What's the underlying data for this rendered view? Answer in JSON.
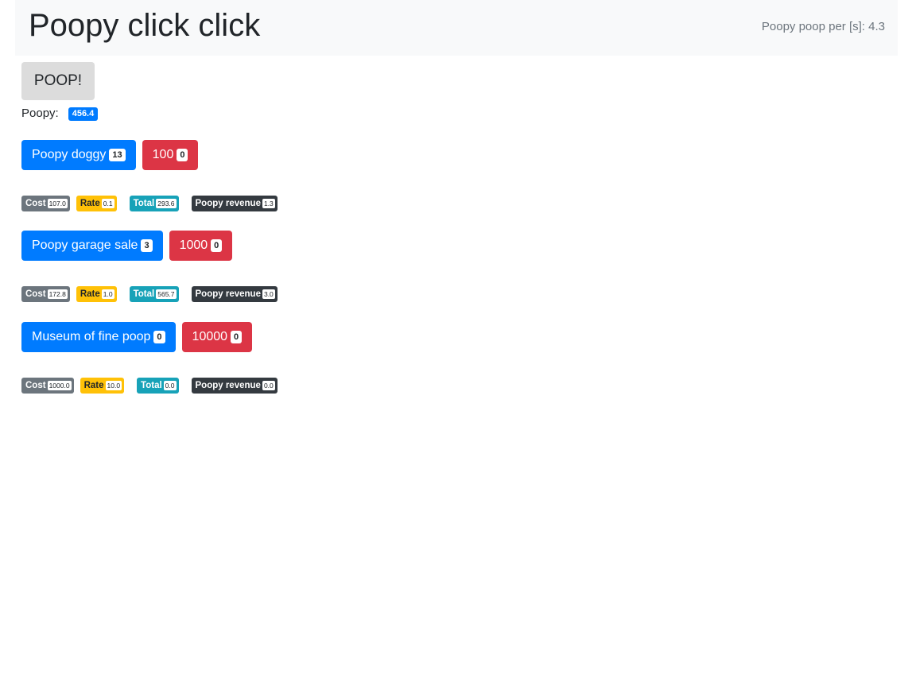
{
  "header": {
    "title": "Poopy click click",
    "rate_label": "Poopy poop per [s]: 4.3"
  },
  "clicker": {
    "button_label": "POOP!",
    "count_label": "Poopy:",
    "count_value": "456.4"
  },
  "buildings": [
    {
      "name": "Poopy doggy",
      "owned": "13",
      "bulk_label": "100",
      "bulk_count": "0",
      "cost_label": "Cost",
      "cost": "107.0",
      "rate_label": "Rate",
      "rate": "0.1",
      "total_label": "Total",
      "total": "293.6",
      "revenue_label": "Poopy revenue",
      "revenue": "1.3"
    },
    {
      "name": "Poopy garage sale",
      "owned": "3",
      "bulk_label": "1000",
      "bulk_count": "0",
      "cost_label": "Cost",
      "cost": "172.8",
      "rate_label": "Rate",
      "rate": "1.0",
      "total_label": "Total",
      "total": "565.7",
      "revenue_label": "Poopy revenue",
      "revenue": "3.0"
    },
    {
      "name": "Museum of fine poop",
      "owned": "0",
      "bulk_label": "10000",
      "bulk_count": "0",
      "cost_label": "Cost",
      "cost": "1000.0",
      "rate_label": "Rate",
      "rate": "10.0",
      "total_label": "Total",
      "total": "0.0",
      "revenue_label": "Poopy revenue",
      "revenue": "0.0"
    }
  ],
  "colors": {
    "primary": "#007bff",
    "danger": "#dc3545",
    "secondary": "#6c757d",
    "warning": "#ffc107",
    "info": "#17a2b8",
    "dark": "#343a40"
  }
}
